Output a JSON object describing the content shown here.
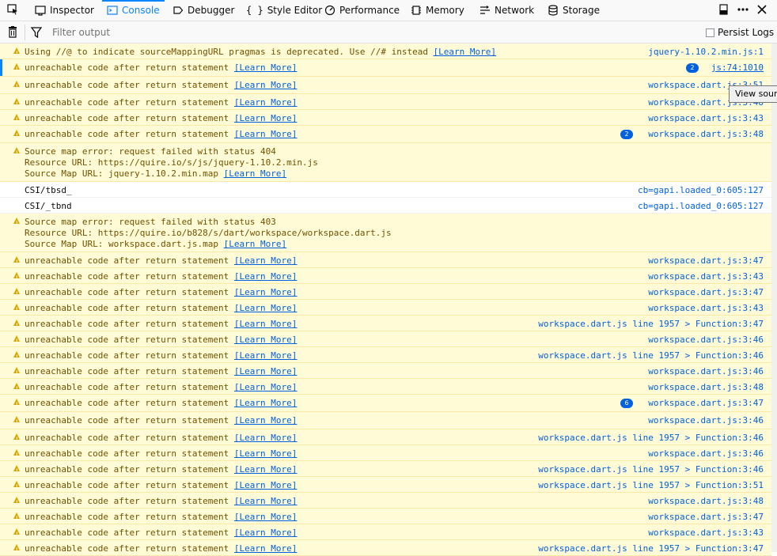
{
  "toolbar": {
    "tabs": [
      {
        "label": "Inspector",
        "icon": "inspector-icon"
      },
      {
        "label": "Console",
        "icon": "console-icon",
        "selected": true
      },
      {
        "label": "Debugger",
        "icon": "debugger-icon"
      },
      {
        "label": "Style Editor",
        "icon": "style-editor-icon"
      },
      {
        "label": "Performance",
        "icon": "performance-icon"
      },
      {
        "label": "Memory",
        "icon": "memory-icon"
      },
      {
        "label": "Network",
        "icon": "network-icon"
      },
      {
        "label": "Storage",
        "icon": "storage-icon"
      }
    ],
    "style_braces": "{ }"
  },
  "filter": {
    "placeholder": "Filter output",
    "persist_label": "Persist Logs",
    "persist_checked": false
  },
  "learn_more": "[Learn More]",
  "messages": [
    {
      "type": "warn",
      "lines": [
        "Using //@ to indicate sourceMappingURL pragmas is deprecated. Use //# instead "
      ],
      "learn": true,
      "source": "jquery-1.10.2.min.js:1"
    },
    {
      "type": "warn",
      "lines": [
        "unreachable code after return statement "
      ],
      "learn": true,
      "source": "js:74:1010",
      "repeat": "2",
      "selected": true
    },
    {
      "type": "warn",
      "lines": [
        "unreachable code after return statement "
      ],
      "learn": true,
      "source": "workspace.dart.js:3:51"
    },
    {
      "type": "warn",
      "lines": [
        "unreachable code after return statement "
      ],
      "learn": true,
      "source": "workspace.dart.js:3:48"
    },
    {
      "type": "warn",
      "lines": [
        "unreachable code after return statement "
      ],
      "learn": true,
      "source": "workspace.dart.js:3:43"
    },
    {
      "type": "warn",
      "lines": [
        "unreachable code after return statement "
      ],
      "learn": true,
      "source": "workspace.dart.js:3:48",
      "repeat": "2"
    },
    {
      "type": "warn",
      "lines": [
        "Source map error: request failed with status 404",
        "Resource URL: https://quire.io/s/js/jquery-1.10.2.min.js",
        "Source Map URL: jquery-1.10.2.min.map "
      ],
      "learn": true,
      "source": ""
    },
    {
      "type": "log",
      "lines": [
        "CSI/tbsd_"
      ],
      "learn": false,
      "source": "cb=gapi.loaded_0:605:127"
    },
    {
      "type": "log",
      "lines": [
        "CSI/_tbnd"
      ],
      "learn": false,
      "source": "cb=gapi.loaded_0:605:127"
    },
    {
      "type": "warn",
      "lines": [
        "Source map error: request failed with status 403",
        "Resource URL: https://quire.io/b828/s/dart/workspace/workspace.dart.js",
        "Source Map URL: workspace.dart.js.map "
      ],
      "learn": true,
      "source": ""
    },
    {
      "type": "warn",
      "lines": [
        "unreachable code after return statement "
      ],
      "learn": true,
      "source": "workspace.dart.js:3:47"
    },
    {
      "type": "warn",
      "lines": [
        "unreachable code after return statement "
      ],
      "learn": true,
      "source": "workspace.dart.js:3:43"
    },
    {
      "type": "warn",
      "lines": [
        "unreachable code after return statement "
      ],
      "learn": true,
      "source": "workspace.dart.js:3:47"
    },
    {
      "type": "warn",
      "lines": [
        "unreachable code after return statement "
      ],
      "learn": true,
      "source": "workspace.dart.js:3:43"
    },
    {
      "type": "warn",
      "lines": [
        "unreachable code after return statement "
      ],
      "learn": true,
      "source": "workspace.dart.js line 1957 > Function:3:47"
    },
    {
      "type": "warn",
      "lines": [
        "unreachable code after return statement "
      ],
      "learn": true,
      "source": "workspace.dart.js:3:46"
    },
    {
      "type": "warn",
      "lines": [
        "unreachable code after return statement "
      ],
      "learn": true,
      "source": "workspace.dart.js line 1957 > Function:3:46"
    },
    {
      "type": "warn",
      "lines": [
        "unreachable code after return statement "
      ],
      "learn": true,
      "source": "workspace.dart.js:3:46"
    },
    {
      "type": "warn",
      "lines": [
        "unreachable code after return statement "
      ],
      "learn": true,
      "source": "workspace.dart.js:3:48"
    },
    {
      "type": "warn",
      "lines": [
        "unreachable code after return statement "
      ],
      "learn": true,
      "source": "workspace.dart.js:3:47",
      "repeat": "6"
    },
    {
      "type": "warn",
      "lines": [
        "unreachable code after return statement "
      ],
      "learn": true,
      "source": "workspace.dart.js:3:46"
    },
    {
      "type": "warn",
      "lines": [
        "unreachable code after return statement "
      ],
      "learn": true,
      "source": "workspace.dart.js line 1957 > Function:3:46"
    },
    {
      "type": "warn",
      "lines": [
        "unreachable code after return statement "
      ],
      "learn": true,
      "source": "workspace.dart.js:3:46"
    },
    {
      "type": "warn",
      "lines": [
        "unreachable code after return statement "
      ],
      "learn": true,
      "source": "workspace.dart.js line 1957 > Function:3:46"
    },
    {
      "type": "warn",
      "lines": [
        "unreachable code after return statement "
      ],
      "learn": true,
      "source": "workspace.dart.js line 1957 > Function:3:51"
    },
    {
      "type": "warn",
      "lines": [
        "unreachable code after return statement "
      ],
      "learn": true,
      "source": "workspace.dart.js:3:48"
    },
    {
      "type": "warn",
      "lines": [
        "unreachable code after return statement "
      ],
      "learn": true,
      "source": "workspace.dart.js:3:47"
    },
    {
      "type": "warn",
      "lines": [
        "unreachable code after return statement "
      ],
      "learn": true,
      "source": "workspace.dart.js:3:43"
    },
    {
      "type": "warn",
      "lines": [
        "unreachable code after return statement "
      ],
      "learn": true,
      "source": "workspace.dart.js line 1957 > Function:3:47"
    }
  ],
  "tooltip": "View source",
  "colors": {
    "accent": "#0a84ff",
    "warn_bg": "#fffbd6",
    "warn_text": "#715100",
    "link": "#0060df"
  }
}
